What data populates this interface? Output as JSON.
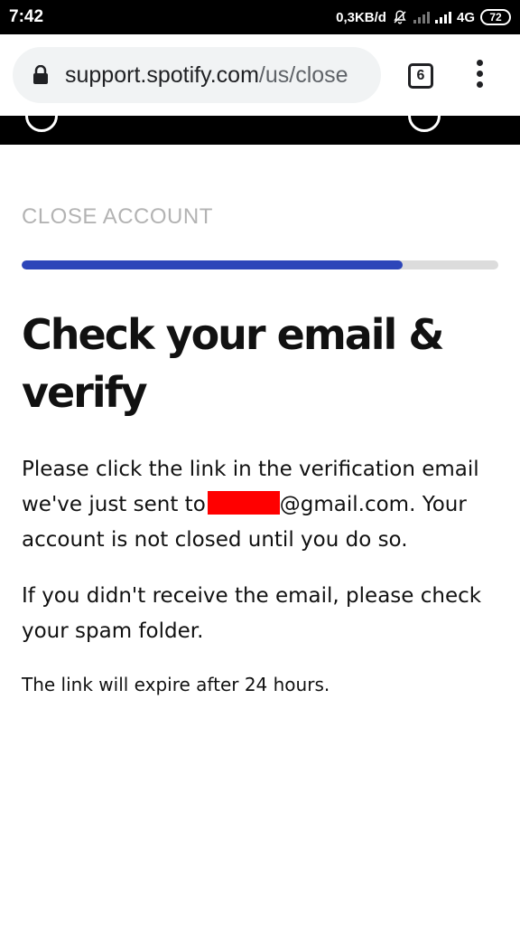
{
  "status_bar": {
    "time": "7:42",
    "network_speed": "0,3KB/d",
    "network_type": "4G",
    "battery": "72",
    "icons": [
      "bell-off-icon",
      "signal-icon",
      "signal-icon",
      "battery-icon"
    ]
  },
  "browser": {
    "url_host": "support.spotify.com",
    "url_path": "/us/close",
    "tab_count": "6",
    "lock_icon": "lock-icon",
    "menu_icon": "kebab-menu-icon"
  },
  "page": {
    "section_label": "CLOSE ACCOUNT",
    "progress": 0.8,
    "heading": "Check your email & verify",
    "paragraph1_before": "Please click the link in the verification email we've just sent to",
    "paragraph1_after": "@gmail.com. Your account is not closed until you do so.",
    "paragraph2": "If you didn't receive the email, please check your spam folder.",
    "paragraph3": "The link will expire after 24 hours."
  },
  "colors": {
    "progress_fill": "#2d46b9",
    "progress_track": "#dcdcdc",
    "redaction": "#ff0000",
    "label_gray": "#b3b3b3"
  }
}
